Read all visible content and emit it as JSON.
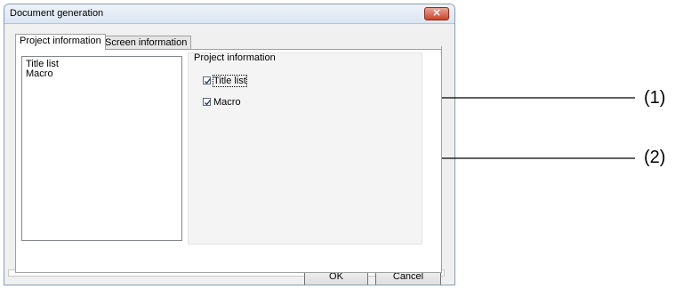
{
  "window": {
    "title": "Document generation",
    "close_glyph": "×"
  },
  "tabs": [
    {
      "label": "Project information",
      "active": true
    },
    {
      "label": "Screen information",
      "active": false
    }
  ],
  "list": {
    "items": [
      "Title list",
      "Macro"
    ]
  },
  "group": {
    "title": "Project information",
    "checkboxes": [
      {
        "label": "Title list",
        "checked": true
      },
      {
        "label": "Macro",
        "checked": true
      }
    ]
  },
  "buttons": {
    "ok": "OK",
    "cancel": "Cancel"
  },
  "callouts": [
    "(1)",
    "(2)"
  ]
}
